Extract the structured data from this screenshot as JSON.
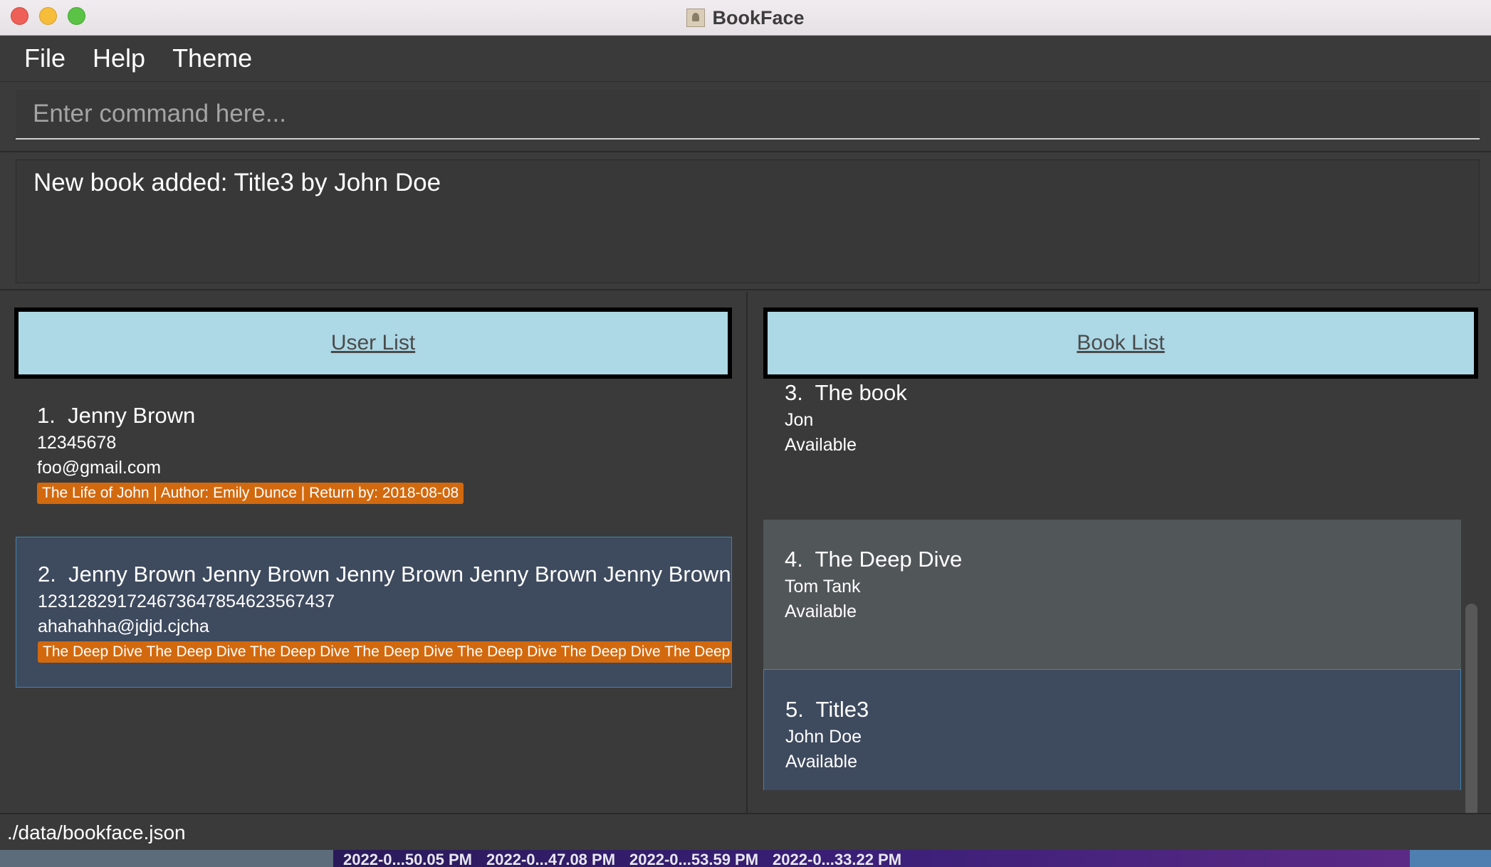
{
  "window": {
    "title": "BookFace"
  },
  "menu": {
    "file": "File",
    "help": "Help",
    "theme": "Theme"
  },
  "command": {
    "placeholder": "Enter command here...",
    "value": ""
  },
  "result": {
    "message": "New book added: Title3 by John Doe"
  },
  "user_list": {
    "header": "User List",
    "items": [
      {
        "index": "1.",
        "name": "Jenny Brown",
        "phone": "12345678",
        "email": "foo@gmail.com",
        "tag": "The Life of John | Author: Emily Dunce | Return by: 2018-08-08"
      },
      {
        "index": "2.",
        "name": "Jenny Brown Jenny Brown Jenny Brown Jenny Brown Jenny Brown Je",
        "phone": "123128291724673647854623567437",
        "email": "ahahahha@jdjd.cjcha",
        "tag": "The Deep Dive The Deep Dive The Deep Dive The Deep Dive The Deep Dive The Deep Dive The Deep Div"
      }
    ]
  },
  "book_list": {
    "header": "Book List",
    "items": [
      {
        "index": "3.",
        "title": "The book",
        "author": "Jon",
        "status": "Available"
      },
      {
        "index": "4.",
        "title": "The Deep Dive",
        "author": "Tom Tank",
        "status": "Available"
      },
      {
        "index": "5.",
        "title": "Title3",
        "author": "John Doe",
        "status": "Available"
      }
    ]
  },
  "status_bar": {
    "path": "./data/bookface.json"
  },
  "desktop": {
    "taskbar": [
      "2022-0...50.05 PM",
      "2022-0...47.08 PM",
      "2022-0...53.59 PM",
      "2022-0...33.22 PM"
    ]
  },
  "colors": {
    "accent_header": "#add8e6",
    "tag": "#d2690e",
    "selected": "#3e4a5e",
    "background": "#3a3a3a"
  }
}
